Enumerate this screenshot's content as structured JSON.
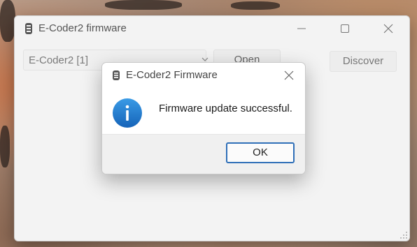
{
  "main_window": {
    "title": "E-Coder2 firmware",
    "icon": "app-icon",
    "controls": {
      "minimize": "minimize-icon",
      "maximize": "maximize-icon",
      "close": "close-icon"
    },
    "device_select": {
      "value": "E-Coder2 [1]",
      "icon": "chevron-down-icon"
    },
    "open_label": "Open",
    "discover_label": "Discover"
  },
  "dialog": {
    "title": "E-Coder2 Firmware",
    "message": "Firmware update successful.",
    "ok_label": "OK",
    "icon": "info-icon",
    "accent_color": "#1a73c9"
  }
}
